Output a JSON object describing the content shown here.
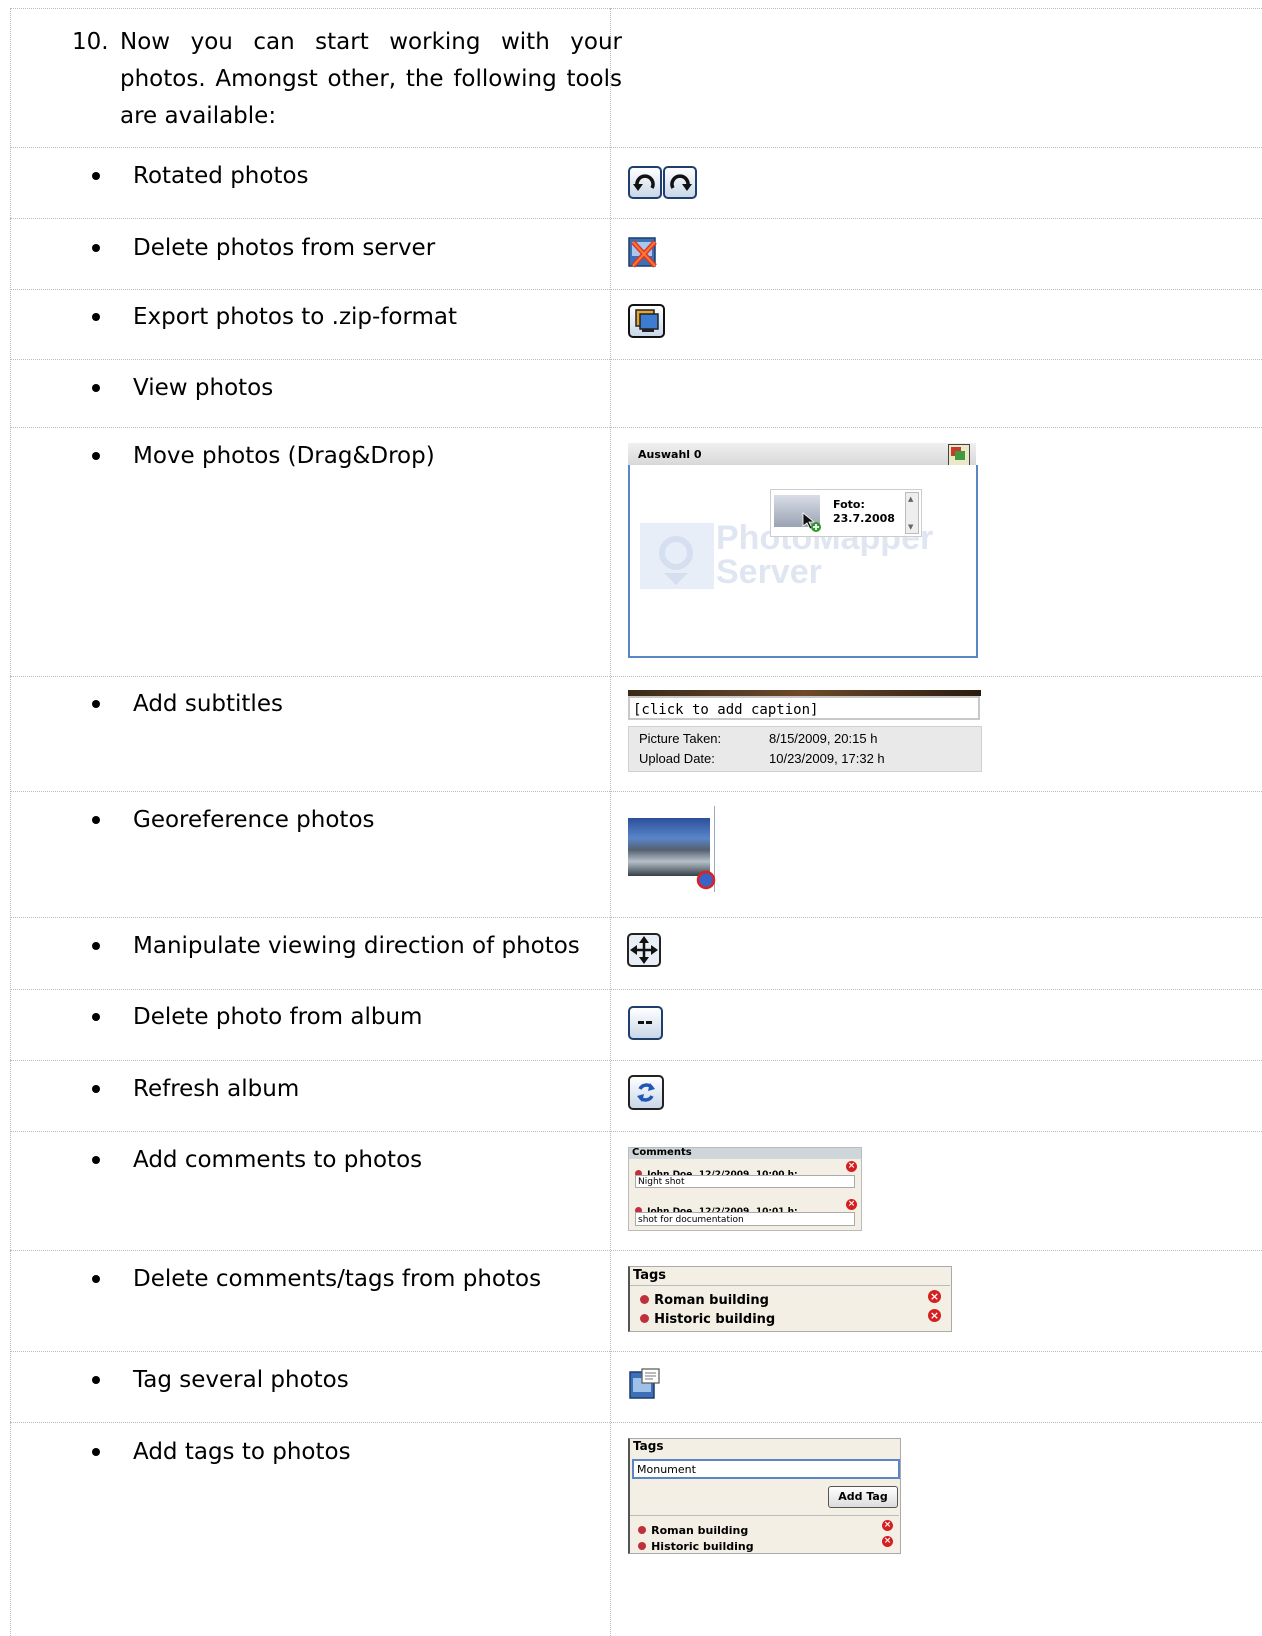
{
  "intro": {
    "number": "10.",
    "text": "Now you can start working with your photos. Amongst other, the following tools are available:"
  },
  "tools": [
    {
      "label": "Rotated photos"
    },
    {
      "label": "Delete photos from server"
    },
    {
      "label": "Export photos to .zip-format"
    },
    {
      "label": "View photos"
    },
    {
      "label": "Move photos (Drag&Drop)"
    },
    {
      "label": "Add subtitles"
    },
    {
      "label": "Georeference photos"
    },
    {
      "label": "Manipulate viewing direction of photos"
    },
    {
      "label": "Delete photo from album"
    },
    {
      "label": "Refresh album"
    },
    {
      "label": "Add comments to photos"
    },
    {
      "label": "Delete comments/tags from photos"
    },
    {
      "label": "Tag several photos"
    },
    {
      "label": "Add tags to photos"
    }
  ],
  "move_panel": {
    "header": "Auswahl 0",
    "foto_label": "Foto:",
    "foto_date": "23.7.2008",
    "watermark_line1": "PhotoMapper",
    "watermark_line2": "Server"
  },
  "subtitle_panel": {
    "caption_placeholder": "[click to add caption]",
    "picture_taken_label": "Picture Taken:",
    "picture_taken_value": "8/15/2009, 20:15 h",
    "upload_date_label": "Upload Date:",
    "upload_date_value": "10/23/2009, 17:32 h"
  },
  "comments_panel": {
    "title": "Comments",
    "entries": [
      {
        "author": "John Doe, 12/2/2009, 10:00 h:",
        "text": "Night shot"
      },
      {
        "author": "John Doe, 12/2/2009, 10:01 h:",
        "text": "shot for documentation"
      }
    ]
  },
  "delete_tags_panel": {
    "title": "Tags",
    "tags": [
      "Roman building",
      "Historic building"
    ]
  },
  "add_tags_panel": {
    "title": "Tags",
    "input_value": "Monument",
    "add_button": "Add Tag",
    "tags": [
      "Roman building",
      "Historic building"
    ]
  },
  "colors": {
    "grid_line": "#bbbbbb",
    "icon_border": "#1e3f6e",
    "delete_red": "#d42020",
    "tag_bullet": "#c0303a"
  }
}
